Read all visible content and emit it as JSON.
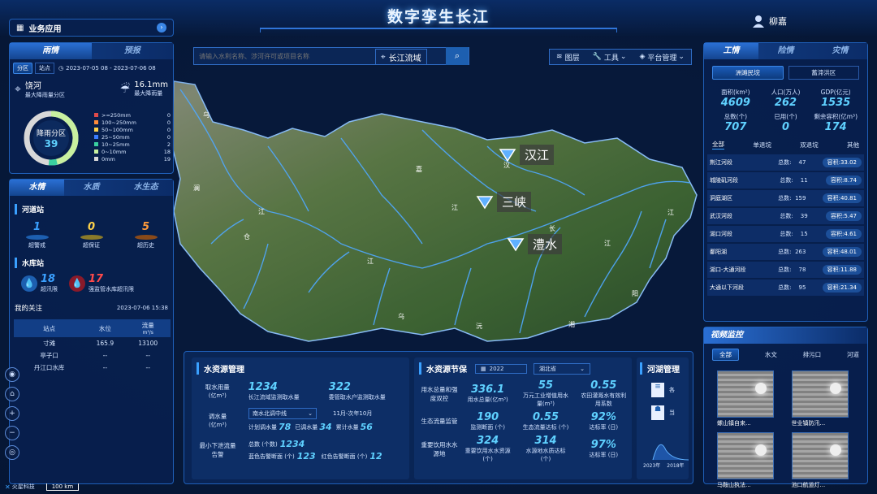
{
  "header": {
    "title": "数字孪生长江",
    "user_name": "柳嘉"
  },
  "left": {
    "biz_label": "业务应用",
    "rain_tabs": [
      "雨情",
      "预报"
    ],
    "rain_subtabs": [
      "分区",
      "站点"
    ],
    "date_range": "2023-07-05 08  -  2023-07-06 08",
    "max_zone": {
      "name": "饶河",
      "desc": "最大降雨量分区"
    },
    "max_rain": {
      "value": "16.1mm",
      "desc": "最大降雨量"
    },
    "donut": {
      "label": "降雨分区",
      "value": "39"
    },
    "legend": [
      {
        "label": ">=250mm",
        "value": "0",
        "color": "#e04a4a"
      },
      {
        "label": "100~250mm",
        "value": "0",
        "color": "#ff8c3a"
      },
      {
        "label": "50~100mm",
        "value": "0",
        "color": "#ffd34a"
      },
      {
        "label": "25~50mm",
        "value": "0",
        "color": "#3a7cff"
      },
      {
        "label": "10~25mm",
        "value": "2",
        "color": "#3ad0a0"
      },
      {
        "label": "0~10mm",
        "value": "18",
        "color": "#c8f0a0"
      },
      {
        "label": "0mm",
        "value": "19",
        "color": "#d8d8d8"
      }
    ],
    "water_tabs": [
      "水情",
      "水质",
      "水生态"
    ],
    "river_title": "河道站",
    "river_stats": [
      {
        "value": "1",
        "label": "超警戒",
        "color": "#3aa0ff"
      },
      {
        "value": "0",
        "label": "超保证",
        "color": "#ffd34a"
      },
      {
        "value": "5",
        "label": "超历史",
        "color": "#ff9a3a"
      }
    ],
    "reservoir_title": "水库站",
    "reservoir_stats": [
      {
        "value": "18",
        "label": "超汛限",
        "color": "#3aa0ff"
      },
      {
        "value": "17",
        "label": "强监管水库超汛限",
        "color": "#ff4a4a"
      }
    ],
    "focus_title": "我的关注",
    "focus_time": "2023-07-06 15:38",
    "table_headers": [
      "站点",
      "水位",
      "流量"
    ],
    "flow_unit": "m³/s",
    "table_rows": [
      [
        "寸滩",
        "165.9",
        "13100"
      ],
      [
        "亭子口",
        "--",
        "--"
      ],
      [
        "丹江口水库",
        "--",
        "--"
      ]
    ]
  },
  "search": {
    "placeholder": "请输入水利名称、涉河许可或项目名称",
    "basin": "长江流域"
  },
  "toolbar": {
    "layers": "图层",
    "tools": "工具",
    "platform": "平台管理"
  },
  "map": {
    "markers": [
      {
        "label": "汉江"
      },
      {
        "label": "三峡"
      },
      {
        "label": "澧水"
      }
    ],
    "scale": "100 km",
    "brand": "火星科技",
    "place_labels": [
      "乌",
      "江",
      "嘉",
      "汉",
      "长",
      "江",
      "江",
      "乌",
      "沅",
      "湘",
      "仓",
      "阳",
      "澜",
      "江",
      "江"
    ]
  },
  "right": {
    "tabs": [
      "工情",
      "险情",
      "灾情"
    ],
    "subtabs": [
      "洲滩民垸",
      "蓄滞洪区"
    ],
    "stats": [
      {
        "label": "面积(km²)",
        "value": "4609"
      },
      {
        "label": "人口(万人)",
        "value": "262"
      },
      {
        "label": "GDP(亿元)",
        "value": "1535"
      },
      {
        "label": "总数(个)",
        "value": "707"
      },
      {
        "label": "已用(个)",
        "value": "0"
      },
      {
        "label": "剩余容积(亿m³)",
        "value": "174"
      }
    ],
    "filters": [
      "全部",
      "单退垸",
      "双退垸",
      "其他"
    ],
    "list_total_label": "总数:",
    "list_cap_label": "容积:",
    "list": [
      {
        "name": "荆江河段",
        "total": "47",
        "cap": "33.02"
      },
      {
        "name": "城陵矶河段",
        "total": "11",
        "cap": "8.74"
      },
      {
        "name": "洞庭湖区",
        "total": "159",
        "cap": "40.81"
      },
      {
        "name": "武汉河段",
        "total": "39",
        "cap": "5.47"
      },
      {
        "name": "湖口河段",
        "total": "15",
        "cap": "4.61"
      },
      {
        "name": "鄱阳湖",
        "total": "263",
        "cap": "48.01"
      },
      {
        "name": "湖口-大通河段",
        "total": "78",
        "cap": "11.88"
      },
      {
        "name": "大通以下河段",
        "total": "95",
        "cap": "21.34"
      }
    ],
    "video_title": "视频监控",
    "video_tabs": [
      "全部",
      "水文",
      "排污口",
      "河道"
    ],
    "videos": [
      {
        "caption": "螺山镇自来..."
      },
      {
        "caption": "世业镇防汛..."
      },
      {
        "caption": "马鞍山执法..."
      },
      {
        "caption": "池口航道灯..."
      }
    ]
  },
  "bottom": {
    "wr_title": "水资源管理",
    "wr1_label": "取水用量",
    "wr1_unit": "(亿m³)",
    "wr1_a_value": "1234",
    "wr1_a_desc": "长江流域监测取水量",
    "wr1_b_value": "322",
    "wr1_b_desc": "委管取水户监测取水量",
    "wr2_label": "调水量",
    "wr2_unit": "(亿m³)",
    "wr2_select": "南水北调中线",
    "wr2_period": "11月-次年10月",
    "wr2_plan_label": "计划调水量",
    "wr2_plan": "78",
    "wr2_done_label": "已调水量",
    "wr2_done": "34",
    "wr2_acc_label": "累计水量",
    "wr2_acc": "56",
    "wr3_label": "最小下泄流量告警",
    "wr3_total_label": "总数 (个数)",
    "wr3_total": "1234",
    "wr3_blue_label": "蓝色告警断面 (个)",
    "wr3_blue": "123",
    "wr3_red_label": "红色告警断面 (个)",
    "wr3_red": "12",
    "wp_title": "水资源节保",
    "wp_year": "2022",
    "wp_province": "湖北省",
    "wp_rows": [
      {
        "label": "用水总量和强度双控",
        "items": [
          {
            "value": "336.1",
            "desc": "用水总量(亿m³)"
          },
          {
            "value": "55",
            "desc": "万元工业增值用水量(m³)"
          },
          {
            "value": "0.55",
            "desc": "农田灌溉水有效利用系数"
          }
        ]
      },
      {
        "label": "生态流量监管",
        "items": [
          {
            "value": "190",
            "desc": "监测断面 (个)"
          },
          {
            "value": "0.55",
            "desc": "生态流量达标 (个)"
          },
          {
            "value": "92%",
            "desc": "达标率 (日)"
          }
        ]
      },
      {
        "label": "重要饮用水水源地",
        "items": [
          {
            "value": "324",
            "desc": "重要饮用水水资源 (个)"
          },
          {
            "value": "314",
            "desc": "水源地水质达标 (个)"
          },
          {
            "value": "97%",
            "desc": "达标率 (日)"
          }
        ]
      }
    ],
    "rl_title": "河湖管理",
    "rl_side1": "各",
    "rl_side2": "当",
    "rl_years": [
      "2023年",
      "2018年"
    ]
  }
}
